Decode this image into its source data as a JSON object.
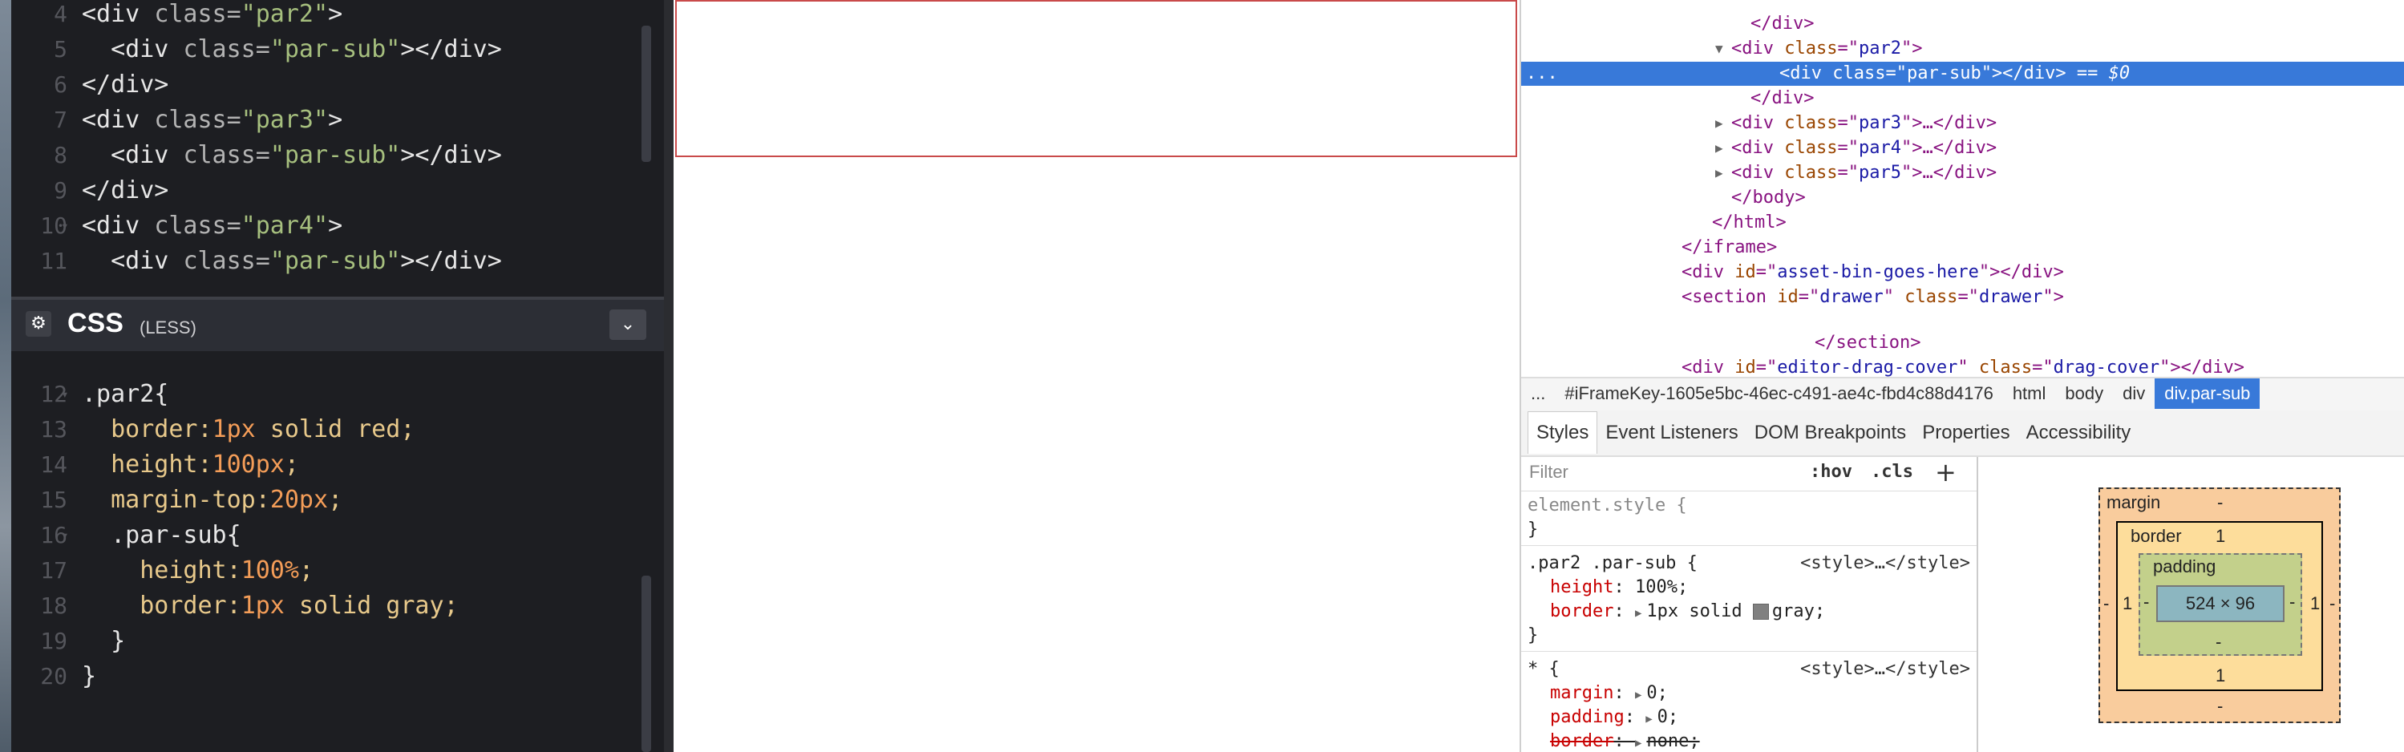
{
  "html_editor": {
    "lines": [
      {
        "n": "4",
        "indent": "",
        "parts": [
          [
            "tag",
            "<div "
          ],
          [
            "attr",
            "class="
          ],
          [
            "str",
            "\"par2\""
          ],
          [
            "tag",
            ">"
          ]
        ]
      },
      {
        "n": "5",
        "indent": "  ",
        "parts": [
          [
            "tag",
            "<div "
          ],
          [
            "attr",
            "class="
          ],
          [
            "str",
            "\"par-sub\""
          ],
          [
            "tag",
            "></div>"
          ]
        ]
      },
      {
        "n": "6",
        "indent": "",
        "parts": [
          [
            "tag",
            "</div>"
          ]
        ]
      },
      {
        "n": "7",
        "indent": "",
        "parts": [
          [
            "tag",
            "<div "
          ],
          [
            "attr",
            "class="
          ],
          [
            "str",
            "\"par3\""
          ],
          [
            "tag",
            ">"
          ]
        ]
      },
      {
        "n": "8",
        "indent": "  ",
        "parts": [
          [
            "tag",
            "<div "
          ],
          [
            "attr",
            "class="
          ],
          [
            "str",
            "\"par-sub\""
          ],
          [
            "tag",
            "></div>"
          ]
        ]
      },
      {
        "n": "9",
        "indent": "",
        "parts": [
          [
            "tag",
            "</div>"
          ]
        ]
      },
      {
        "n": "10",
        "indent": "",
        "parts": [
          [
            "tag",
            "<div "
          ],
          [
            "attr",
            "class="
          ],
          [
            "str",
            "\"par4\""
          ],
          [
            "tag",
            ">"
          ]
        ]
      },
      {
        "n": "11",
        "indent": "  ",
        "parts": [
          [
            "tag",
            "<div "
          ],
          [
            "attr",
            "class="
          ],
          [
            "str",
            "\"par-sub\""
          ],
          [
            "tag",
            "></div>"
          ]
        ]
      }
    ]
  },
  "css_panel": {
    "title": "CSS",
    "subtitle": "(LESS)",
    "gear_icon": "gear-icon",
    "collapse_icon": "chevron-down-icon"
  },
  "css_editor": {
    "lines": [
      {
        "n": "12",
        "indent": "",
        "parts": [
          [
            "sel",
            ".par2{"
          ]
        ]
      },
      {
        "n": "13",
        "indent": "  ",
        "parts": [
          [
            "prop",
            "border:"
          ],
          [
            "num",
            "1px"
          ],
          [
            "val",
            " solid red;"
          ]
        ]
      },
      {
        "n": "14",
        "indent": "  ",
        "parts": [
          [
            "prop",
            "height:"
          ],
          [
            "num",
            "100px"
          ],
          [
            "val",
            ";"
          ]
        ]
      },
      {
        "n": "15",
        "indent": "  ",
        "parts": [
          [
            "prop",
            "margin-top:"
          ],
          [
            "num",
            "20px"
          ],
          [
            "val",
            ";"
          ]
        ]
      },
      {
        "n": "16",
        "indent": "  ",
        "parts": [
          [
            "sel",
            ".par-sub{"
          ]
        ]
      },
      {
        "n": "17",
        "indent": "    ",
        "parts": [
          [
            "prop",
            "height:"
          ],
          [
            "num",
            "100%"
          ],
          [
            "val",
            ";"
          ]
        ]
      },
      {
        "n": "18",
        "indent": "    ",
        "parts": [
          [
            "prop",
            "border:"
          ],
          [
            "num",
            "1px"
          ],
          [
            "val",
            " solid gray;"
          ]
        ]
      },
      {
        "n": "19",
        "indent": "  ",
        "parts": [
          [
            "sel",
            "}"
          ]
        ]
      },
      {
        "n": "20",
        "indent": "",
        "parts": [
          [
            "sel",
            "}"
          ]
        ]
      }
    ]
  },
  "dom_tree": {
    "lines": [
      {
        "indent": 282,
        "tri": "",
        "html": [
          [
            "t",
            "</div>"
          ]
        ]
      },
      {
        "indent": 258,
        "tri": "▼",
        "html": [
          [
            "t",
            "<div "
          ],
          [
            "a",
            "class"
          ],
          [
            "t",
            "=\""
          ],
          [
            "v",
            "par2"
          ],
          [
            "t",
            "\">"
          ]
        ]
      },
      {
        "indent": 318,
        "tri": "",
        "selected": true,
        "prefix": "...",
        "html": [
          [
            "t",
            "<div "
          ],
          [
            "a",
            "class"
          ],
          [
            "t",
            "=\""
          ],
          [
            "v",
            "par-sub"
          ],
          [
            "t",
            "\"></div>"
          ],
          [
            "eq",
            " == $0"
          ]
        ]
      },
      {
        "indent": 282,
        "tri": "",
        "html": [
          [
            "t",
            "</div>"
          ]
        ]
      },
      {
        "indent": 258,
        "tri": "▶",
        "html": [
          [
            "t",
            "<div "
          ],
          [
            "a",
            "class"
          ],
          [
            "t",
            "=\""
          ],
          [
            "v",
            "par3"
          ],
          [
            "t",
            "\">…</div>"
          ]
        ]
      },
      {
        "indent": 258,
        "tri": "▶",
        "html": [
          [
            "t",
            "<div "
          ],
          [
            "a",
            "class"
          ],
          [
            "t",
            "=\""
          ],
          [
            "v",
            "par4"
          ],
          [
            "t",
            "\">…</div>"
          ]
        ]
      },
      {
        "indent": 258,
        "tri": "▶",
        "html": [
          [
            "t",
            "<div "
          ],
          [
            "a",
            "class"
          ],
          [
            "t",
            "=\""
          ],
          [
            "v",
            "par5"
          ],
          [
            "t",
            "\">…</div>"
          ]
        ]
      },
      {
        "indent": 258,
        "tri": "",
        "html": [
          [
            "t",
            "</body>"
          ]
        ]
      },
      {
        "indent": 234,
        "tri": "",
        "html": [
          [
            "t",
            "</html>"
          ]
        ]
      },
      {
        "indent": 196,
        "tri": "",
        "html": [
          [
            "t",
            "</iframe>"
          ]
        ]
      },
      {
        "indent": 196,
        "tri": "",
        "html": [
          [
            "t",
            "<div "
          ],
          [
            "a",
            "id"
          ],
          [
            "t",
            "=\""
          ],
          [
            "v",
            "asset-bin-goes-here"
          ],
          [
            "t",
            "\"></div>"
          ]
        ]
      },
      {
        "indent": 196,
        "tri": "",
        "html": [
          [
            "t",
            "<section "
          ],
          [
            "a",
            "id"
          ],
          [
            "t",
            "=\""
          ],
          [
            "v",
            "drawer"
          ],
          [
            "t",
            "\" "
          ],
          [
            "a",
            "class"
          ],
          [
            "t",
            "=\""
          ],
          [
            "v",
            "drawer"
          ],
          [
            "t",
            "\">"
          ]
        ]
      },
      {
        "indent": 0,
        "tri": "",
        "html": []
      },
      {
        "indent": 362,
        "tri": "",
        "html": [
          [
            "t",
            "</section>"
          ]
        ]
      },
      {
        "indent": 196,
        "tri": "",
        "html": [
          [
            "t",
            "<div "
          ],
          [
            "a",
            "id"
          ],
          [
            "t",
            "=\""
          ],
          [
            "v",
            "editor-drag-cover"
          ],
          [
            "t",
            "\" "
          ],
          [
            "a",
            "class"
          ],
          [
            "t",
            "=\""
          ],
          [
            "v",
            "drag-cover"
          ],
          [
            "t",
            "\"></div>"
          ]
        ]
      },
      {
        "indent": 196,
        "tri": "",
        "html": [
          [
            "t",
            "</div>"
          ]
        ]
      }
    ]
  },
  "breadcrumbs": [
    "...",
    "#iFrameKey-1605e5bc-46ec-c491-ae4c-fbd4c88d4176",
    "html",
    "body",
    "div",
    "div.par-sub"
  ],
  "styles_tabs": [
    "Styles",
    "Event Listeners",
    "DOM Breakpoints",
    "Properties",
    "Accessibility"
  ],
  "filter": {
    "placeholder": "Filter",
    "hov": ":hov",
    "cls": ".cls",
    "plus": "+"
  },
  "rules": [
    {
      "selector": "element.style {",
      "source": "",
      "props": [],
      "close": "}"
    },
    {
      "selector": ".par2 .par-sub {",
      "source": "<style>…</style>",
      "props": [
        {
          "name": "height",
          "value": "100%;"
        },
        {
          "name": "border",
          "value": "1px solid ",
          "swatch": true,
          "after": "gray;",
          "arrow": true
        }
      ],
      "close": "}"
    },
    {
      "selector": "* {",
      "source": "<style>…</style>",
      "props": [
        {
          "name": "margin",
          "value": "0;",
          "arrow": true
        },
        {
          "name": "padding",
          "value": "0;",
          "arrow": true
        },
        {
          "name": "border",
          "value": "none;",
          "arrow": true,
          "strike": true
        }
      ],
      "close": ""
    }
  ],
  "box_model": {
    "margin_label": "margin",
    "margin_top": "-",
    "margin_bottom": "-",
    "margin_left": "-",
    "margin_right": "-",
    "border_label": "border",
    "border_top": "1",
    "border_bottom": "1",
    "border_left": "1",
    "border_right": "1",
    "padding_label": "padding",
    "padding_top": "",
    "padding_bottom": "-",
    "padding_left": "-",
    "padding_right": "-",
    "content": "524 × 96"
  },
  "colors": {
    "preview_border": "#c94a4a",
    "selection": "#3879d9"
  }
}
